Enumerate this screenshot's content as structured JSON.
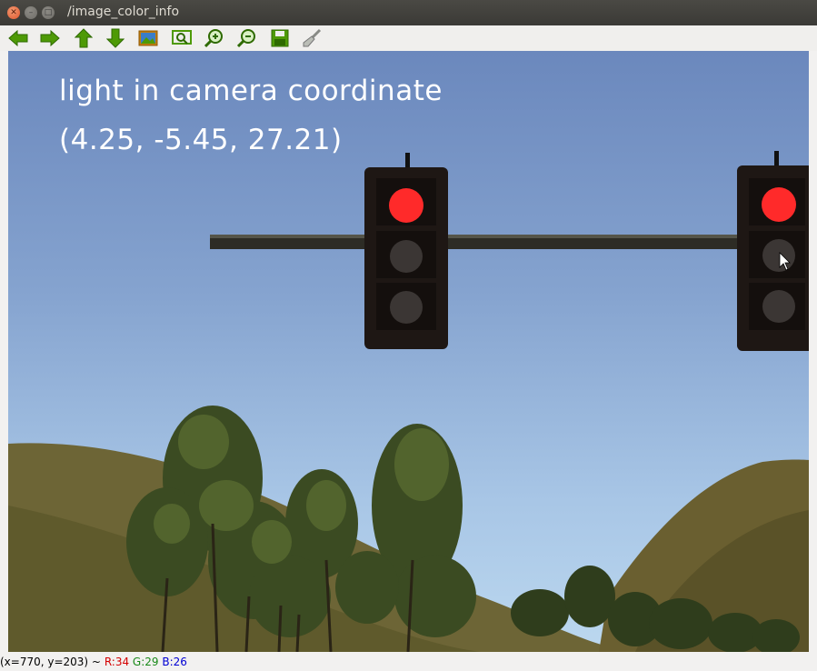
{
  "window": {
    "title": "/image_color_info"
  },
  "toolbar": {
    "buttons": [
      {
        "icon": "arrow-left-icon"
      },
      {
        "icon": "arrow-right-icon"
      },
      {
        "icon": "arrow-up-icon"
      },
      {
        "icon": "arrow-down-icon"
      },
      {
        "icon": "image-icon"
      },
      {
        "icon": "zoom-fit-icon"
      },
      {
        "icon": "zoom-in-icon"
      },
      {
        "icon": "zoom-out-icon"
      },
      {
        "icon": "save-icon"
      },
      {
        "icon": "clear-brush-icon"
      }
    ]
  },
  "image": {
    "overlay_line1": "light in camera coordinate",
    "overlay_line2": "(4.25, -5.45, 27.21)"
  },
  "status": {
    "coords": "(x=770, y=203) ~",
    "r": "R:34",
    "g": "G:29",
    "b": "B:26"
  },
  "colors": {
    "red_light": "#ff2a2a",
    "status_r": "#d40000",
    "status_g": "#1a8a1a",
    "status_b": "#0000d4"
  }
}
